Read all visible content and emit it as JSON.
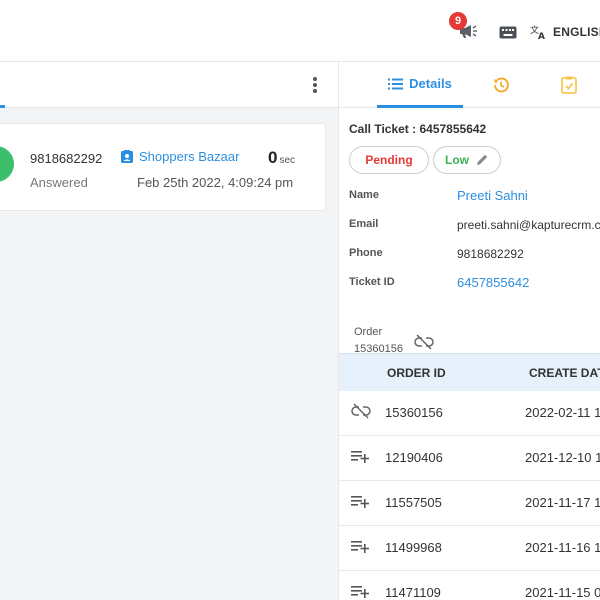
{
  "header": {
    "notification_count": "9",
    "language_label": "ENGLISH"
  },
  "call": {
    "number": "9818682292",
    "status": "Answered",
    "store": "Shoppers Bazaar",
    "duration_value": "0",
    "duration_unit": "sec",
    "datetime": "Feb 25th 2022, 4:09:24 pm"
  },
  "right": {
    "tabs": {
      "details_label": "Details"
    },
    "ticket_title": "Call Ticket : 6457855642",
    "status_pill": "Pending",
    "priority_pill": "Low",
    "fields": {
      "name_label": "Name",
      "name_value": "Preeti Sahni",
      "email_label": "Email",
      "email_value": "preeti.sahni@kapturecrm.com",
      "phone_label": "Phone",
      "phone_value": "9818682292",
      "ticket_label": "Ticket ID",
      "ticket_value": "6457855642"
    },
    "order": {
      "label": "Order",
      "value": "15360156"
    },
    "table": {
      "col_order": "ORDER ID",
      "col_date": "CREATE DATE",
      "rows": [
        {
          "id": "15360156",
          "date": "2022-02-11 1",
          "icon": "unlink-icon"
        },
        {
          "id": "12190406",
          "date": "2021-12-10 1",
          "icon": "playlist-add-icon"
        },
        {
          "id": "11557505",
          "date": "2021-11-17 1",
          "icon": "playlist-add-icon"
        },
        {
          "id": "11499968",
          "date": "2021-11-16 1",
          "icon": "playlist-add-icon"
        },
        {
          "id": "11471109",
          "date": "2021-11-15 0",
          "icon": "playlist-add-icon"
        }
      ]
    }
  },
  "colors": {
    "accent": "#2d8fe0",
    "pending": "#e53935",
    "low": "#3cae5a",
    "history_icon": "#f5a623",
    "avatar": "#3cbf6a"
  }
}
